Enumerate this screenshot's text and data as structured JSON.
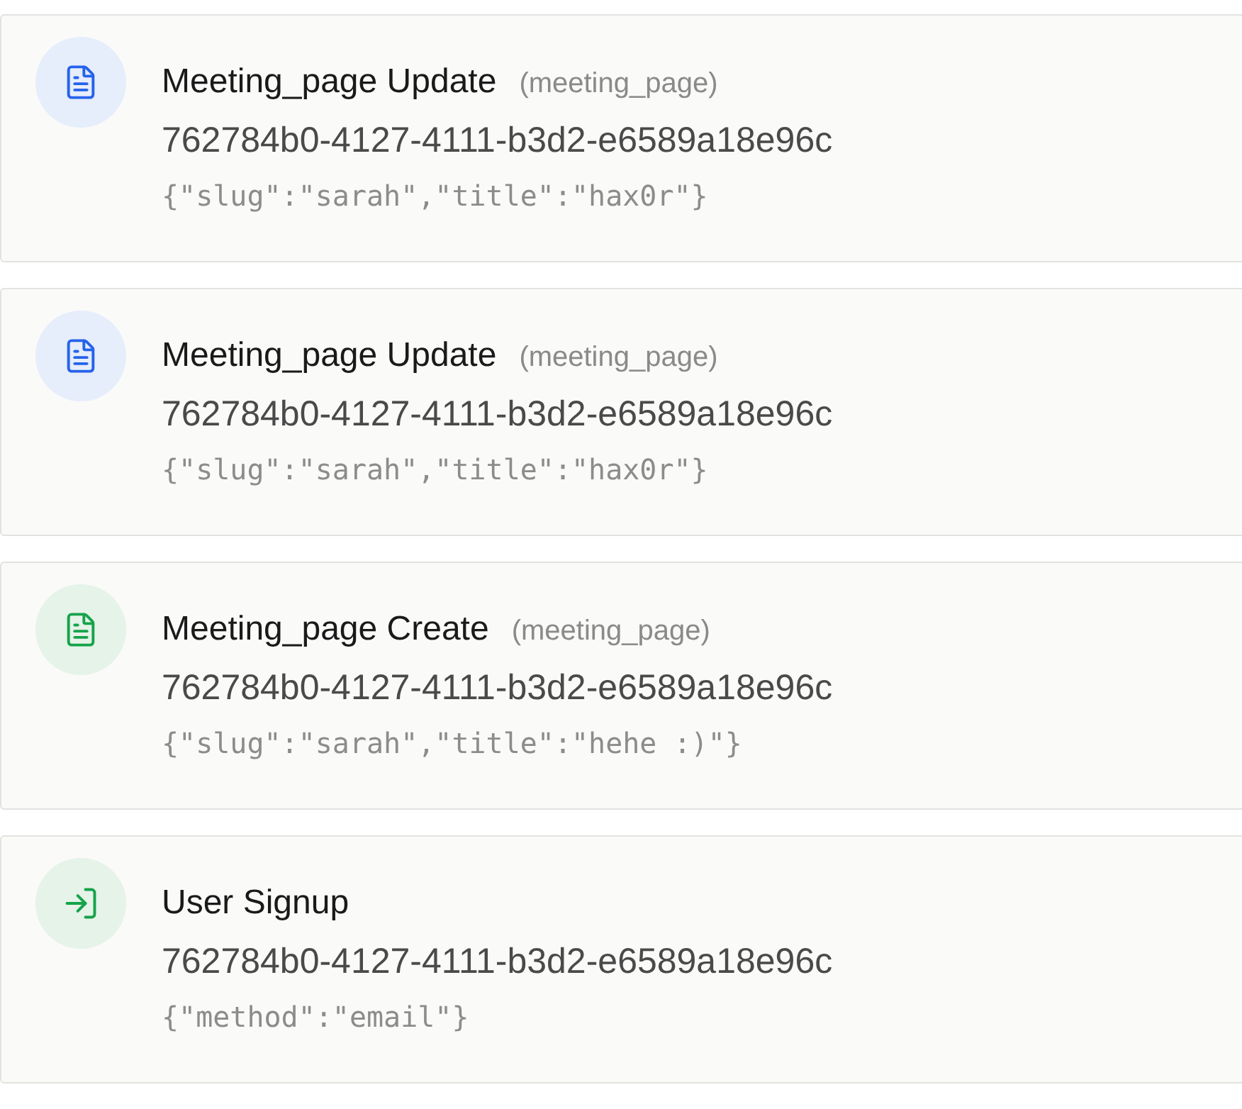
{
  "events": [
    {
      "kind": "update",
      "title": "Meeting_page Update",
      "type": "(meeting_page)",
      "id": "762784b0-4127-4111-b3d2-e6589a18e96c",
      "payload": "{\"slug\":\"sarah\",\"title\":\"hax0r\"}"
    },
    {
      "kind": "update",
      "title": "Meeting_page Update",
      "type": "(meeting_page)",
      "id": "762784b0-4127-4111-b3d2-e6589a18e96c",
      "payload": "{\"slug\":\"sarah\",\"title\":\"hax0r\"}"
    },
    {
      "kind": "create",
      "title": "Meeting_page Create",
      "type": "(meeting_page)",
      "id": "762784b0-4127-4111-b3d2-e6589a18e96c",
      "payload": "{\"slug\":\"sarah\",\"title\":\"hehe :)\"}"
    },
    {
      "kind": "signup",
      "title": "User Signup",
      "id": "762784b0-4127-4111-b3d2-e6589a18e96c",
      "payload": "{\"method\":\"email\"}"
    }
  ]
}
